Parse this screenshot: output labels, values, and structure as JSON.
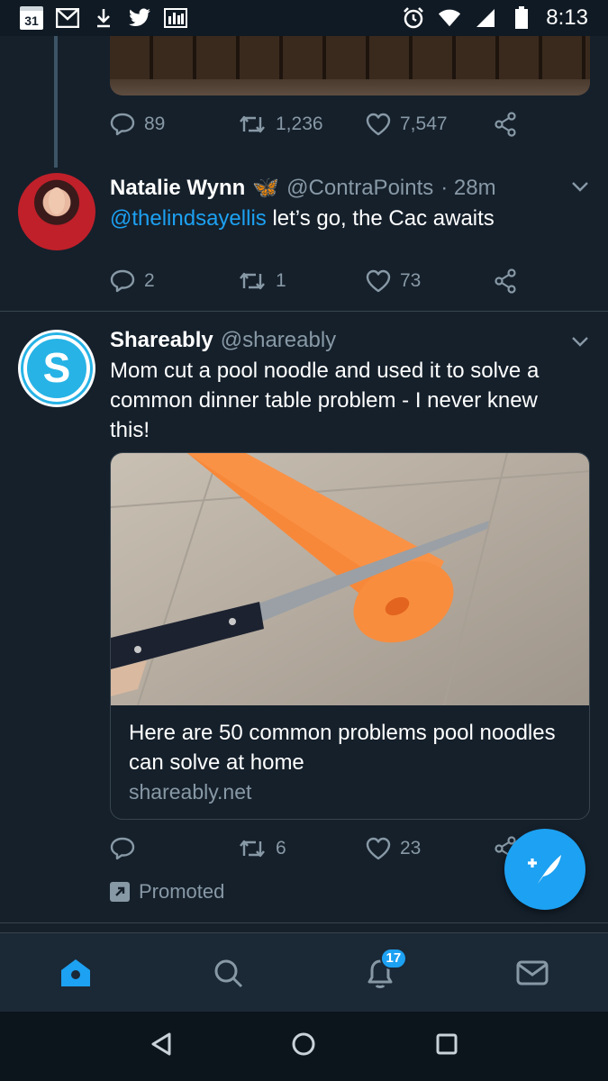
{
  "status_bar": {
    "calendar_day": "31",
    "time": "8:13",
    "left_icons": [
      "calendar-icon",
      "gmail-icon",
      "download-icon",
      "twitter-icon",
      "bar-chart-icon"
    ],
    "right_icons": [
      "alarm-icon",
      "wifi-icon",
      "signal-icon",
      "battery-icon"
    ]
  },
  "tweets": [
    {
      "actions": {
        "replies": "89",
        "retweets": "1,236",
        "likes": "7,547"
      }
    },
    {
      "name": "Natalie Wynn",
      "name_emoji": "🦋",
      "handle": "@ContraPoints",
      "time": "· 28m",
      "mention": "@thelindsayellis",
      "text": " let’s go, the Cac awaits",
      "actions": {
        "replies": "2",
        "retweets": "1",
        "likes": "73"
      }
    },
    {
      "name": "Shareably",
      "handle": "@shareably",
      "avatar_letter": "S",
      "text": "Mom cut a pool noodle and used it to solve a common dinner table problem - I never knew this!",
      "card": {
        "title": "Here are 50 common problems pool noodles can solve at home",
        "domain": "shareably.net"
      },
      "actions": {
        "replies": "",
        "retweets": "6",
        "likes": "23"
      },
      "promoted_label": "Promoted"
    }
  ],
  "bottom_nav": {
    "items": [
      "home-icon",
      "search-icon",
      "notifications-icon",
      "messages-icon"
    ],
    "notification_count": "17"
  },
  "colors": {
    "background": "#15202b",
    "accent": "#1da1f2",
    "muted": "#8899a6",
    "divider": "#38444d"
  }
}
